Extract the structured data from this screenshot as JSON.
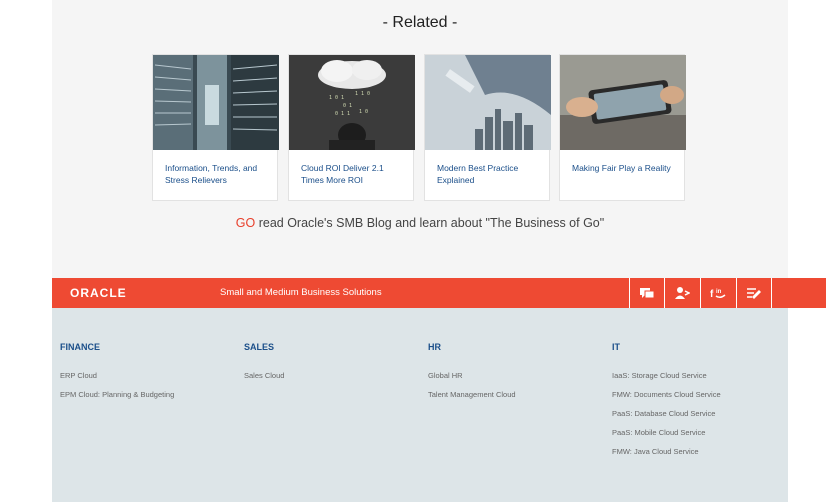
{
  "related": {
    "title": "- Related -",
    "cards": [
      {
        "caption": "Information, Trends, and Stress Relievers",
        "image": "server-racks-image"
      },
      {
        "caption": "Cloud ROI Deliver 2.1 Times More ROI",
        "image": "cloud-over-person-image"
      },
      {
        "caption": "Modern Best Practice Explained",
        "image": "business-tablet-city-image"
      },
      {
        "caption": "Making Fair Play a Reality",
        "image": "hands-tablet-image"
      }
    ]
  },
  "go_line": {
    "go": "GO",
    "text": " read Oracle's SMB Blog and learn about \"The Business of Go\""
  },
  "bar": {
    "logo": "ORACLE",
    "subtitle": "Small and Medium Business Solutions",
    "icons": [
      "chat-icon",
      "contact-icon",
      "social-icon",
      "edit-icon"
    ],
    "color": "#ee4a33"
  },
  "footer": {
    "columns": [
      {
        "heading": "FINANCE",
        "links": [
          "ERP Cloud",
          "EPM Cloud: Planning & Budgeting"
        ]
      },
      {
        "heading": "SALES",
        "links": [
          "Sales Cloud"
        ]
      },
      {
        "heading": "HR",
        "links": [
          "Global HR",
          "Talent Management Cloud"
        ]
      },
      {
        "heading": "IT",
        "links": [
          "IaaS: Storage Cloud Service",
          "FMW: Documents Cloud Service",
          "PaaS: Database Cloud Service",
          "PaaS: Mobile Cloud Service",
          "FMW: Java Cloud Service"
        ]
      }
    ]
  }
}
